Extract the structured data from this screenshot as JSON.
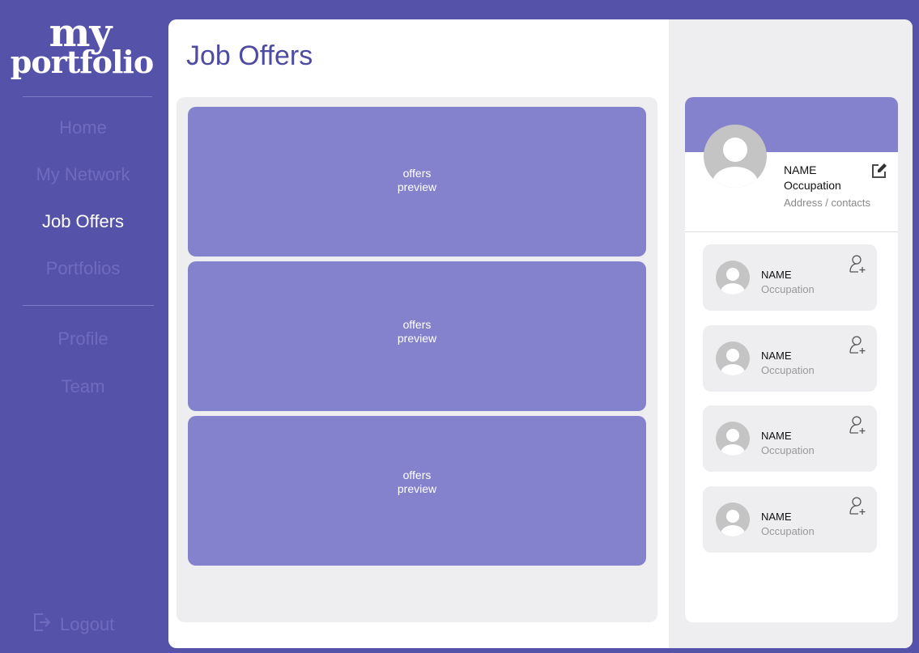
{
  "sidebar": {
    "logo_line1": "my",
    "logo_line2": "portfolio",
    "nav": [
      {
        "label": "Home"
      },
      {
        "label": "My Network"
      },
      {
        "label": "Job Offers"
      },
      {
        "label": "Portfolios"
      }
    ],
    "secondary": [
      {
        "label": "Profile"
      },
      {
        "label": "Team"
      }
    ],
    "logout_label": "Logout",
    "logout_icon": "logout-icon"
  },
  "main": {
    "title": "Job Offers",
    "offers": [
      {
        "line1": "offers",
        "line2": "preview"
      },
      {
        "line1": "offers",
        "line2": "preview"
      },
      {
        "line1": "offers",
        "line2": "preview"
      }
    ]
  },
  "profile": {
    "name": "NAME",
    "occupation": "Occupation",
    "address": "Address / contacts",
    "edit_icon": "edit-icon"
  },
  "contacts": [
    {
      "name": "NAME",
      "occupation": "Occupation"
    },
    {
      "name": "NAME",
      "occupation": "Occupation"
    },
    {
      "name": "NAME",
      "occupation": "Occupation"
    },
    {
      "name": "NAME",
      "occupation": "Occupation"
    }
  ],
  "colors": {
    "sidebar_bg": "#5552a9",
    "accent": "#8482cd",
    "title": "#4e4ba3",
    "panel_bg": "#eeedf0",
    "nav_inactive": "#6f6cbf",
    "nav_active": "#ffffff"
  }
}
